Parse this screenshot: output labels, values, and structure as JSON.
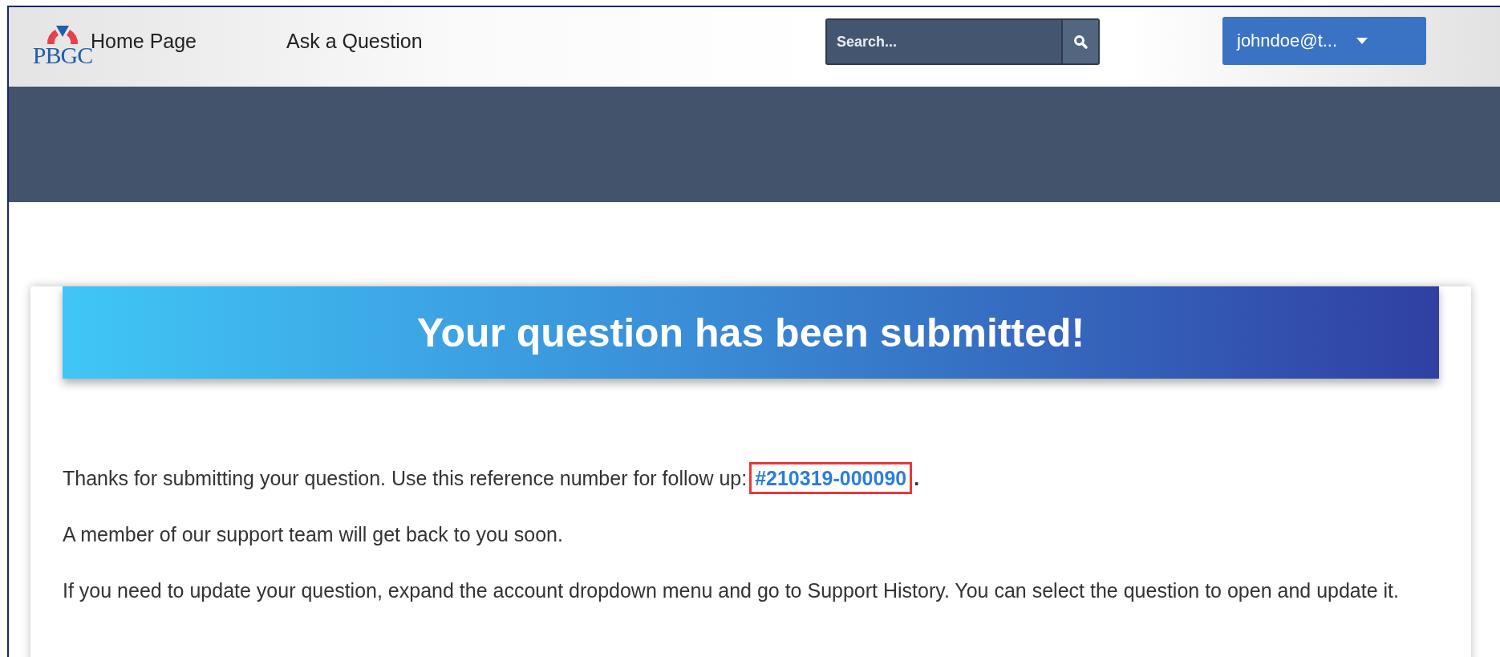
{
  "header": {
    "logo": "PBGC",
    "nav": [
      {
        "label": "Home Page"
      },
      {
        "label": "Ask a Question"
      }
    ],
    "search": {
      "placeholder": "Search..."
    },
    "account": {
      "label": "johndoe@t..."
    }
  },
  "confirmation": {
    "title": "Your question has been submitted!",
    "intro": "Thanks for submitting your question. Use this reference number for follow up: ",
    "reference": "#210319-000090",
    "intro_end": ".",
    "reference_highlighted": true,
    "paragraphs": [
      "A member of our support team will get back to you soon.",
      "If you need to update your question, expand the account dropdown menu and go to Support History. You can select the question to open and update it."
    ]
  }
}
